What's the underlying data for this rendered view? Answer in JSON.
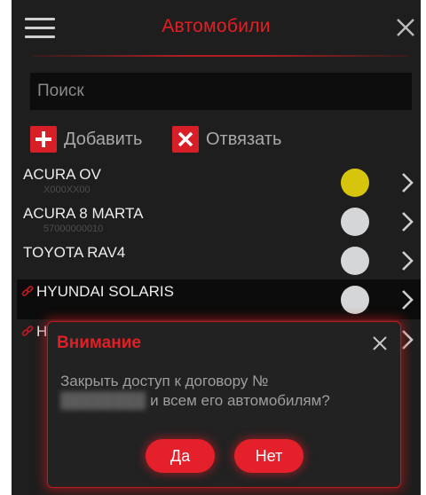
{
  "header": {
    "title": "Автомобили",
    "menu_icon": "hamburger-icon",
    "close_icon": "close-icon"
  },
  "search": {
    "placeholder": "Поиск"
  },
  "actions": {
    "add_label": "Добавить",
    "unbind_label": "Отвязать"
  },
  "cars": [
    {
      "name": "ACURA OV",
      "plate": "X000XX00",
      "status_color": "#d6c40d",
      "linked": false,
      "selected": false
    },
    {
      "name": "ACURA 8 MARTA",
      "plate": "57000000010",
      "status_color": "#d5d6d8",
      "linked": false,
      "selected": false
    },
    {
      "name": "TOYOTA RAV4",
      "plate": "",
      "status_color": "#d5d6d8",
      "linked": false,
      "selected": false
    },
    {
      "name": "HYUNDAI SOLARIS",
      "plate": "",
      "status_color": "#d5d6d8",
      "linked": true,
      "selected": true
    },
    {
      "name": "H",
      "plate": "",
      "status_color": "#d5d6d8",
      "linked": true,
      "selected": false
    }
  ],
  "dialog": {
    "title": "Внимание",
    "message_line1": "Закрыть доступ к договору №",
    "contract_number": "",
    "message_line2": "и всем его автомобилям?",
    "yes_label": "Да",
    "no_label": "Нет"
  },
  "colors": {
    "accent": "#e31e24",
    "background": "#1e1e1e",
    "status_yellow": "#d6c40d",
    "status_grey": "#d5d6d8"
  }
}
